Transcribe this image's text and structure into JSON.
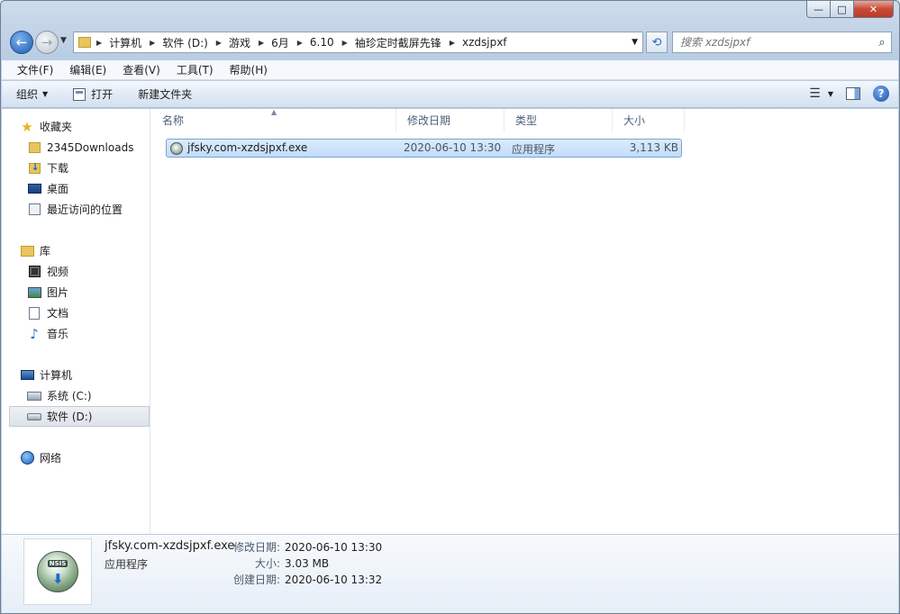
{
  "window": {
    "minimize_glyph": "—",
    "maximize_glyph": "□",
    "close_glyph": "✕"
  },
  "nav": {
    "back_glyph": "←",
    "forward_glyph": "→",
    "breadcrumbs": [
      "计算机",
      "软件 (D:)",
      "游戏",
      "6月",
      "6.10",
      "袖珍定时截屏先锋",
      "xzdsjpxf"
    ],
    "search_placeholder": "搜索 xzdsjpxf"
  },
  "menu": [
    "文件(F)",
    "编辑(E)",
    "查看(V)",
    "工具(T)",
    "帮助(H)"
  ],
  "toolbar": {
    "organize": "组织",
    "open": "打开",
    "new_folder": "新建文件夹",
    "help_glyph": "?"
  },
  "sidebar": {
    "favorites": {
      "label": "收藏夹",
      "items": [
        "2345Downloads",
        "下载",
        "桌面",
        "最近访问的位置"
      ]
    },
    "libraries": {
      "label": "库",
      "items": [
        "视频",
        "图片",
        "文档",
        "音乐"
      ]
    },
    "computer": {
      "label": "计算机",
      "items": [
        "系统 (C:)",
        "软件 (D:)"
      ]
    },
    "network": {
      "label": "网络"
    }
  },
  "columns": [
    "名称",
    "修改日期",
    "类型",
    "大小"
  ],
  "files": [
    {
      "name": "jfsky.com-xzdsjpxf.exe",
      "modified": "2020-06-10 13:30",
      "type": "应用程序",
      "size": "3,113 KB"
    }
  ],
  "details": {
    "name": "jfsky.com-xzdsjpxf.exe",
    "type": "应用程序",
    "icon_label": "NSIS",
    "labels": [
      "修改日期:",
      "大小:",
      "创建日期:"
    ],
    "values": [
      "2020-06-10 13:30",
      "3.03 MB",
      "2020-06-10 13:32"
    ]
  }
}
